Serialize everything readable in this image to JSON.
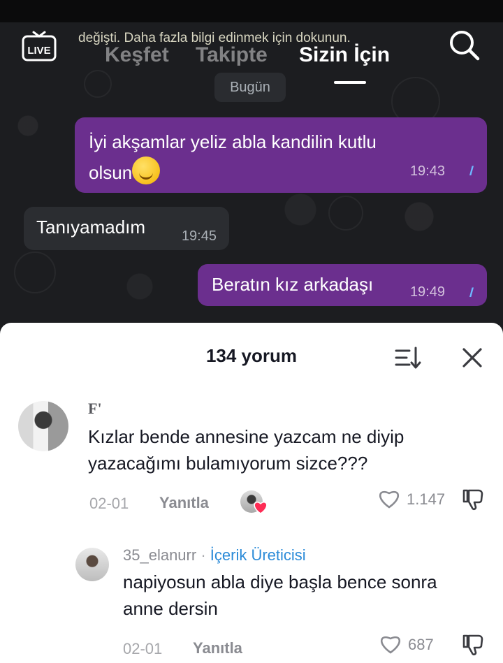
{
  "header": {
    "tabs": [
      {
        "label": "Keşfet"
      },
      {
        "label": "Takipte"
      },
      {
        "label": "Sizin İçin"
      }
    ],
    "toast": "değişti. Daha fazla bilgi edinmek için dokunun.",
    "live_label": "LIVE"
  },
  "chat": {
    "date_label": "Bugün",
    "messages": [
      {
        "text": "İyi akşamlar yeliz abla kandilin kutlu olsun",
        "time": "19:43",
        "direction": "out",
        "status": "read"
      },
      {
        "text": "Tanıyamadım",
        "time": "19:45",
        "direction": "in"
      },
      {
        "text": "Beratın kız arkadaşı",
        "time": "19:49",
        "direction": "out",
        "status": "read"
      }
    ]
  },
  "comments": {
    "title": "134 yorum",
    "items": [
      {
        "user": "F'",
        "text": "Kızlar bende annesine yazcam ne diyip yazacağımı bulamıyorum sizce???",
        "date": "02-01",
        "reply_label": "Yanıtla",
        "likes": "1.147"
      }
    ],
    "reply": {
      "user": "35_elanurr",
      "separator": "·",
      "badge": "İçerik Üreticisi",
      "text": "napiyosun abla diye başla bence sonra anne dersin",
      "date": "02-01",
      "reply_label": "Yanıtla",
      "likes": "687"
    }
  },
  "colors": {
    "outgoing_bubble": "#6b2f8e",
    "incoming_bubble": "#2b2d31",
    "creator_badge": "#2b8bd8",
    "read_ticks": "#6fb8ff"
  }
}
